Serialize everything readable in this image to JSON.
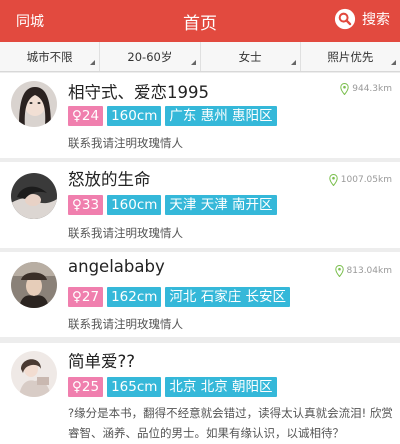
{
  "header": {
    "city_label": "同城",
    "title": "首页",
    "search_label": "搜索"
  },
  "filters": [
    "城市不限",
    "20-60岁",
    "女士",
    "照片优先"
  ],
  "users": [
    {
      "name": "相守式、爱恋1995",
      "age": "♀24",
      "height": "160cm",
      "location": "广东 惠州 惠阳区",
      "distance": "944.3km",
      "motto": "联系我请注明玫瑰情人",
      "avatar_icon": "portrait-woman-dark-hair"
    },
    {
      "name": "怒放的生命",
      "age": "♀33",
      "height": "160cm",
      "location": "天津 天津 南开区",
      "distance": "1007.05km",
      "motto": "联系我请注明玫瑰情人",
      "avatar_icon": "portrait-woman-dark"
    },
    {
      "name": "angelababy",
      "age": "♀27",
      "height": "162cm",
      "location": "河北 石家庄 长安区",
      "distance": "813.04km",
      "motto": "联系我请注明玫瑰情人",
      "avatar_icon": "portrait-woman-hat"
    },
    {
      "name": "简单爱??",
      "age": "♀25",
      "height": "165cm",
      "location": "北京 北京 朝阳区",
      "distance": "",
      "motto": "?缘分是本书，翻得不经意就会错过，读得太认真就会流泪! 欣赏睿智、涵养、品位的男士。如果有缘认识，以诚相待？",
      "avatar_icon": "portrait-woman-light"
    }
  ],
  "colors": {
    "header_bg": "#e24a3f",
    "gender_tag": "#f07fae",
    "info_tag": "#35b8d9"
  }
}
